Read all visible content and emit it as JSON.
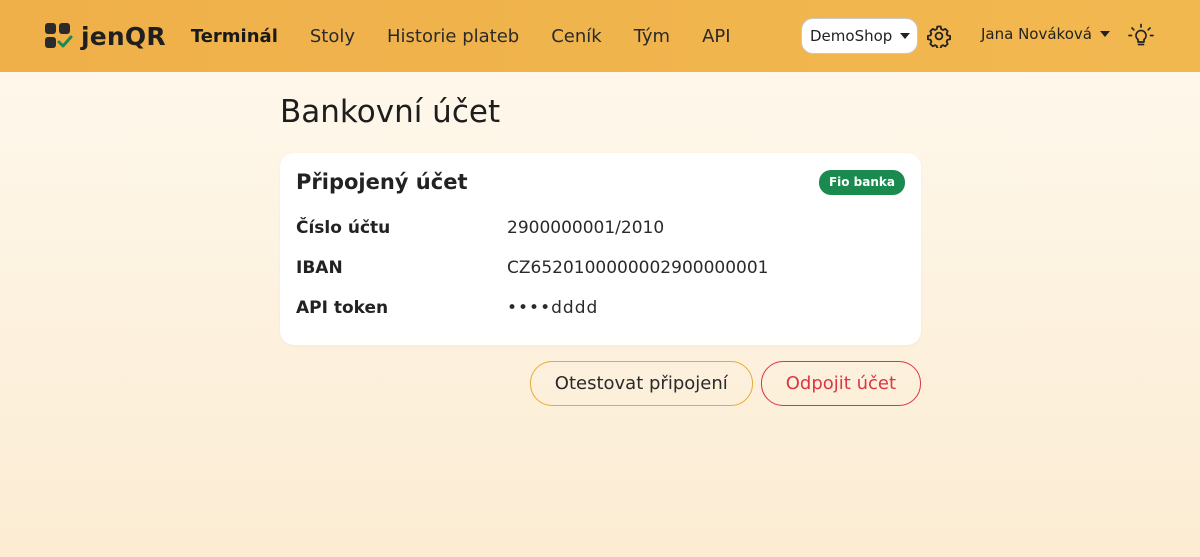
{
  "brand": {
    "name": "jenQR"
  },
  "nav": {
    "items": [
      {
        "label": "Terminál",
        "active": true
      },
      {
        "label": "Stoly"
      },
      {
        "label": "Historie plateb"
      },
      {
        "label": "Ceník"
      },
      {
        "label": "Tým"
      },
      {
        "label": "API"
      }
    ]
  },
  "shop": {
    "selected": "DemoShop"
  },
  "user": {
    "name": "Jana Nováková"
  },
  "page": {
    "title": "Bankovní účet"
  },
  "account_card": {
    "title": "Připojený účet",
    "bank_badge": "Fio banka",
    "rows": [
      {
        "label": "Číslo účtu",
        "value": "2900000001/2010"
      },
      {
        "label": "IBAN",
        "value": "CZ6520100000002900000001"
      },
      {
        "label": "API token",
        "value": "••••dddd"
      }
    ]
  },
  "actions": {
    "test_label": "Otestovat připojení",
    "disconnect_label": "Odpojit účet"
  },
  "colors": {
    "navbar": "#f0b24c",
    "badge": "#1b8a4e",
    "danger": "#dc3545",
    "token": "#d6336c",
    "test_border": "#e6a93c"
  },
  "icons": [
    "logo-icon",
    "gear-icon",
    "lightbulb-icon",
    "chevron-down-icon"
  ]
}
